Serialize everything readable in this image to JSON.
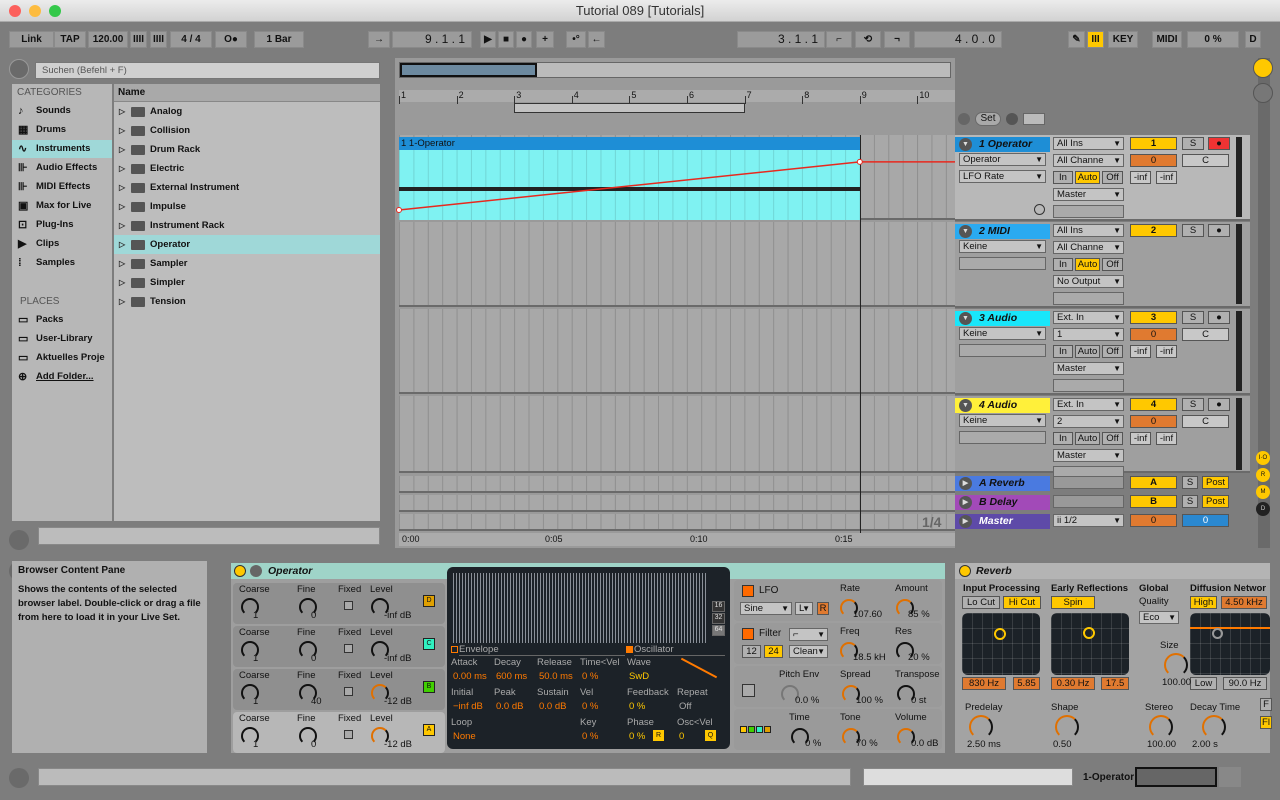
{
  "window": {
    "title": "Tutorial 089  [Tutorials]"
  },
  "toolbar": {
    "link": "Link",
    "tap": "TAP",
    "tempo": "120.00",
    "nudge_down": "IIII",
    "nudge_up": "IIII",
    "signature": "4 / 4",
    "metronome": "O●",
    "quantize": "1 Bar",
    "follow": "→",
    "position": "9 .  1 .  1",
    "play": "▶",
    "stop": "■",
    "record": "●",
    "overdub": "+",
    "automation_arm": "•°",
    "back_to_arrangement": "←",
    "loop_start": "3 .  1 .  1",
    "punch_in": "⌐",
    "loop": "⟲",
    "punch_out": "¬",
    "loop_length": "4 .  0 .  0",
    "draw": "✎",
    "computer_midi": "III",
    "key": "KEY",
    "midi": "MIDI",
    "cpu": "0 %",
    "disk": "D"
  },
  "browser": {
    "search_placeholder": "Suchen (Befehl + F)",
    "categories_header": "CATEGORIES",
    "categories": [
      {
        "label": "Sounds",
        "icon": "♪"
      },
      {
        "label": "Drums",
        "icon": "▦"
      },
      {
        "label": "Instruments",
        "icon": "∿",
        "selected": true
      },
      {
        "label": "Audio Effects",
        "icon": "⊪"
      },
      {
        "label": "MIDI Effects",
        "icon": "⊪"
      },
      {
        "label": "Max for Live",
        "icon": "▣"
      },
      {
        "label": "Plug-Ins",
        "icon": "⊡"
      },
      {
        "label": "Clips",
        "icon": "▶"
      },
      {
        "label": "Samples",
        "icon": "⁞"
      }
    ],
    "places_header": "PLACES",
    "places": [
      {
        "label": "Packs",
        "icon": "▭"
      },
      {
        "label": "User-Library",
        "icon": "▭"
      },
      {
        "label": "Aktuelles Proje",
        "icon": "▭"
      },
      {
        "label": "Add Folder...",
        "icon": "⊕"
      }
    ],
    "name_header": "Name",
    "items": [
      "Analog",
      "Collision",
      "Drum Rack",
      "Electric",
      "External Instrument",
      "Impulse",
      "Instrument Rack",
      "Operator",
      "Sampler",
      "Simpler",
      "Tension"
    ],
    "selected_item": "Operator"
  },
  "arrangement": {
    "bars": [
      "1",
      "2",
      "3",
      "4",
      "5",
      "6",
      "7",
      "8",
      "9",
      "10"
    ],
    "times": [
      "0:00",
      "0:05",
      "0:10",
      "0:15"
    ],
    "zoom_label": "1/4",
    "set_label": "Set",
    "clip_name": "1 1-Operator",
    "automation": {
      "color": "#e8281e",
      "points": [
        [
          1,
          0.12
        ],
        [
          9,
          0.7
        ],
        [
          10.7,
          0.7
        ]
      ]
    }
  },
  "tracks": [
    {
      "name": "1 Operator",
      "color": "#1e8ed6",
      "text": "#111",
      "input": "All Ins",
      "channel": "All Channe",
      "device": "Operator",
      "param": "LFO Rate",
      "monitor": [
        "In",
        "Auto",
        "Off"
      ],
      "output": "Master",
      "number": "1",
      "solo": "S",
      "arm": "●",
      "volume": "0",
      "pan": "C",
      "peak1": "-inf",
      "peak2": "-inf"
    },
    {
      "name": "2 MIDI",
      "color": "#2aaaf0",
      "text": "#111",
      "input": "All Ins",
      "channel": "All Channe",
      "device": "Keine",
      "monitor": [
        "In",
        "Auto",
        "Off"
      ],
      "output": "No Output",
      "number": "2",
      "solo": "S",
      "arm": "●"
    },
    {
      "name": "3 Audio",
      "color": "#19e6fa",
      "text": "#111",
      "input": "Ext. In",
      "channel": "1",
      "device": "Keine",
      "monitor": [
        "In",
        "Auto",
        "Off"
      ],
      "output": "Master",
      "number": "3",
      "solo": "S",
      "arm": "●",
      "volume": "0",
      "pan": "C",
      "peak1": "-inf",
      "peak2": "-inf"
    },
    {
      "name": "4 Audio",
      "color": "#fff03a",
      "text": "#111",
      "input": "Ext. In",
      "channel": "2",
      "device": "Keine",
      "monitor": [
        "In",
        "Auto",
        "Off"
      ],
      "output": "Master",
      "number": "4",
      "solo": "S",
      "arm": "●",
      "volume": "0",
      "pan": "C",
      "peak1": "-inf",
      "peak2": "-inf"
    }
  ],
  "returns": [
    {
      "name": "A Reverb",
      "color": "#4a7ae0",
      "number": "A",
      "solo": "S",
      "post": "Post"
    },
    {
      "name": "B Delay",
      "color": "#a24ab8",
      "number": "B",
      "solo": "S",
      "post": "Post"
    },
    {
      "name": "Master",
      "color": "#5e4aa8",
      "output": "ii 1/2",
      "volume": "0",
      "cue": "0"
    }
  ],
  "side_buttons": [
    "I·O",
    "R",
    "M",
    "D"
  ],
  "info": {
    "title": "Browser Content Pane",
    "body": "Shows the contents of the selected browser label. Double-click or drag a file from here to load it in your Live Set."
  },
  "operator": {
    "title": "Operator",
    "oscs": [
      {
        "coarse": "1",
        "fine": "0",
        "level": "-inf dB",
        "letter": "D",
        "color": "#e0a000"
      },
      {
        "coarse": "1",
        "fine": "0",
        "level": "-inf dB",
        "letter": "C",
        "color": "#30f0c0"
      },
      {
        "coarse": "1",
        "fine": "40",
        "level": "-12 dB",
        "letter": "B",
        "color": "#40d000"
      },
      {
        "coarse": "1",
        "fine": "0",
        "level": "-12 dB",
        "letter": "A",
        "color": "#ffc800"
      }
    ],
    "labels": {
      "coarse": "Coarse",
      "fine": "Fine",
      "fixed": "Fixed",
      "level": "Level"
    },
    "display": {
      "zoom": [
        "16",
        "32",
        "64"
      ],
      "envelope": "Envelope",
      "oscillator": "Oscillator",
      "env_params": [
        {
          "label": "Attack",
          "value": "0.00 ms"
        },
        {
          "label": "Decay",
          "value": "600 ms"
        },
        {
          "label": "Release",
          "value": "50.0 ms"
        },
        {
          "label": "Time<Vel",
          "value": "0 %"
        },
        {
          "label": "Initial",
          "value": "−inf dB"
        },
        {
          "label": "Peak",
          "value": "0.0 dB"
        },
        {
          "label": "Sustain",
          "value": "0.0 dB"
        },
        {
          "label": "Vel",
          "value": "0 %"
        },
        {
          "label": "Loop",
          "value": "None"
        },
        {
          "label": "",
          "value": ""
        },
        {
          "label": "",
          "value": ""
        },
        {
          "label": "Key",
          "value": "0 %"
        }
      ],
      "osc_params": [
        {
          "label": "Wave",
          "value": "SwD"
        },
        {
          "label": "Feedback",
          "value": "0 %"
        },
        {
          "label": "Repeat",
          "value": "Off"
        },
        {
          "label": "Phase",
          "value": "0 %"
        },
        {
          "label": "Osc<Vel",
          "value": "0"
        }
      ],
      "r": "R",
      "q": "Q"
    },
    "lfo": {
      "label": "LFO",
      "wave": "Sine",
      "range": "L",
      "retrig": "R",
      "rate_label": "Rate",
      "rate": "107.60",
      "amount_label": "Amount",
      "amount": "85 %"
    },
    "filter": {
      "label": "Filter",
      "type": "⌐",
      "slope12": "12",
      "slope24": "24",
      "circuit": "Clean",
      "freq_label": "Freq",
      "freq": "18.5 kH",
      "res_label": "Res",
      "res": "20 %"
    },
    "pitch": {
      "pitch_env_label": "Pitch Env",
      "pitch_env": "0.0 %",
      "spread_label": "Spread",
      "spread": "100 %",
      "transpose_label": "Transpose",
      "transpose": "0 st"
    },
    "global": {
      "time_label": "Time",
      "time": "0 %",
      "tone_label": "Tone",
      "tone": "70 %",
      "volume_label": "Volume",
      "volume": "0.0 dB"
    }
  },
  "reverb": {
    "title": "Reverb",
    "input_label": "Input Processing",
    "lo_cut": "Lo Cut",
    "hi_cut": "Hi Cut",
    "in_freq": "830 Hz",
    "in_q": "5.85",
    "er_label": "Early Reflections",
    "spin": "Spin",
    "er_rate": "0.30 Hz",
    "er_amount": "17.5",
    "global_label": "Global",
    "quality_label": "Quality",
    "quality": "Eco",
    "size_label": "Size",
    "size": "100.00",
    "diff_label": "Diffusion Networ",
    "high": "High",
    "high_freq": "4.50 kHz",
    "low": "Low",
    "low_freq": "90.0 Hz",
    "predelay_label": "Predelay",
    "predelay": "2.50 ms",
    "shape_label": "Shape",
    "shape": "0.50",
    "stereo_label": "Stereo",
    "stereo": "100.00",
    "decay_label": "Decay Time",
    "decay": "2.00 s",
    "freeze": "F",
    "flat": "Fl"
  },
  "status": {
    "selected_track": "1-Operator"
  }
}
